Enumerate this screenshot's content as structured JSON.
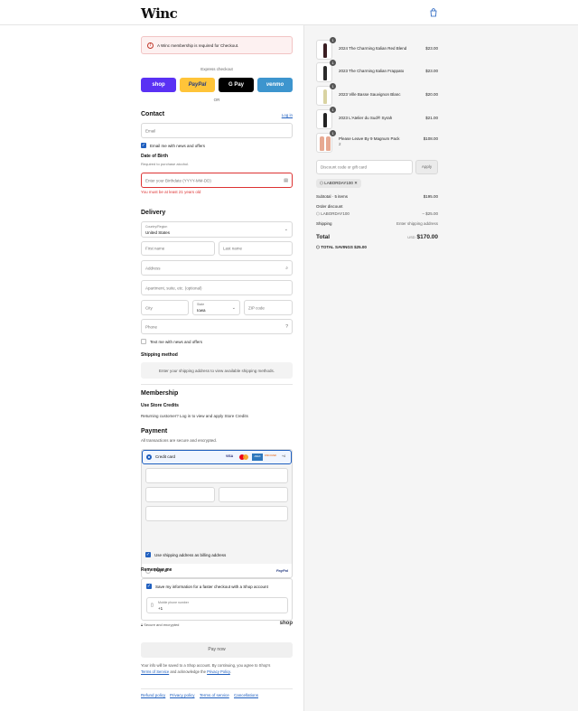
{
  "header": {
    "logo": "Winc",
    "cart_icon": "shopping-bag-icon"
  },
  "alert": {
    "text": "A Winc membership is required for Checkout."
  },
  "express": {
    "label": "Express checkout",
    "buttons": {
      "shop": "shop",
      "paypal": "PayPal",
      "gpay": "G Pay",
      "venmo": "venmo"
    },
    "or": "OR"
  },
  "contact": {
    "title": "Contact",
    "login": "Log in",
    "email_placeholder": "Email",
    "email_news": "Email me with news and offers",
    "dob_title": "Date of Birth",
    "dob_sub": "Required to purchase alcohol.",
    "dob_placeholder": "Enter your Birthdate (YYYY-MM-DD)",
    "dob_error": "You must be at least 21 years old"
  },
  "delivery": {
    "title": "Delivery",
    "country_label": "Country/Region",
    "country_value": "United States",
    "first_name": "First name",
    "last_name": "Last name",
    "address": "Address",
    "apartment": "Apartment, suite, etc. (optional)",
    "city": "City",
    "state_label": "State",
    "state_value": "Iowa",
    "zip": "ZIP code",
    "phone": "Phone",
    "text_news": "Text me with news and offers"
  },
  "shipping": {
    "title": "Shipping method",
    "note": "Enter your shipping address to view available shipping methods."
  },
  "membership": {
    "title": "Membership",
    "subtitle": "Use Store Credits",
    "note": "Returning customer? Log in to view and apply Store Credits"
  },
  "payment": {
    "title": "Payment",
    "note": "All transactions are secure and encrypted.",
    "credit_card": "Credit card",
    "card_brands": [
      "VISA",
      "MC",
      "AMEX",
      "DISCOVER",
      "+4"
    ],
    "billing_same": "Use shipping address as billing address",
    "paypal": "PayPal",
    "paypal_logo": "PayPal"
  },
  "remember": {
    "title": "Remember me",
    "save_info": "Save my information for a faster checkout with a Shop account",
    "mobile_label": "Mobile phone number",
    "mobile_value": "+1",
    "secure": "Secure and encrypted",
    "shop_logo": "shop"
  },
  "pay_now": "Pay now",
  "legal": {
    "text1": "Your info will be saved to a Shop account. By continuing, you agree to Shop's",
    "terms": "Terms of Service",
    "text2": " and acknowledge the ",
    "privacy": "Privacy Policy",
    "text3": "."
  },
  "footer_links": [
    "Refund policy",
    "Privacy policy",
    "Terms of service",
    "Cancellations"
  ],
  "cart": {
    "items": [
      {
        "qty": "1",
        "name": "2024 The Charming Italian Red Blend",
        "price": "$23.00",
        "color": "#3a1e22"
      },
      {
        "qty": "1",
        "name": "2023 The Charming Italian Frappato",
        "price": "$23.00",
        "color": "#2a2a2a"
      },
      {
        "qty": "1",
        "name": "2023 Ville Basse Sauvignon Blanc",
        "price": "$20.00",
        "color": "#d9d3a2"
      },
      {
        "qty": "1",
        "name": "2023 L'Atelier du Sud® Syrah",
        "price": "$21.00",
        "color": "#222222"
      },
      {
        "qty": "1",
        "name": "Please Leave By 9 Magnum Pack",
        "sub": "2",
        "price": "$108.00",
        "color": "#e7a992"
      }
    ],
    "discount_placeholder": "Discount code or gift card",
    "apply": "Apply",
    "code_tag": "LABORDAY100",
    "subtotal_label": "Subtotal · 5 items",
    "subtotal": "$195.00",
    "order_discount": "Order discount",
    "discount_code": "LABORDAY100",
    "discount_value": "– $25.00",
    "shipping_label": "Shipping",
    "shipping_value": "Enter shipping address",
    "total_label": "Total",
    "currency": "USD",
    "total": "$170.00",
    "savings_label": "TOTAL SAVINGS",
    "savings": "$25.00"
  }
}
